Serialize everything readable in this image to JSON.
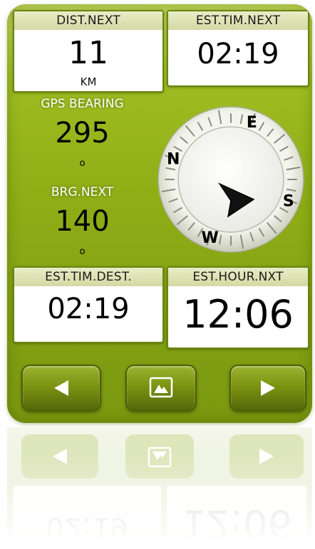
{
  "top_left": {
    "title": "DIST.NEXT",
    "value": "11",
    "unit": "KM"
  },
  "top_right": {
    "title": "EST.TIM.NEXT",
    "value": "02:19"
  },
  "gps_bearing": {
    "label": "GPS BEARING",
    "value": "295",
    "unit": "o"
  },
  "brg_next": {
    "label": "BRG.NEXT",
    "value": "140",
    "unit": "o"
  },
  "compass": {
    "north": "N",
    "east": "E",
    "south": "S",
    "west": "W"
  },
  "bottom_left": {
    "title": "EST.TIM.DEST.",
    "value": "02:19"
  },
  "bottom_right": {
    "title": "EST.HOUR.NXT",
    "value": "12:06"
  },
  "nav": {
    "prev_icon": "left-triangle-icon",
    "view_icon": "screen-view-icon",
    "next_icon": "right-triangle-icon"
  },
  "colors": {
    "accent": "#8fae16",
    "dark": "#55680a",
    "panel_head": "#d2d9a3"
  }
}
